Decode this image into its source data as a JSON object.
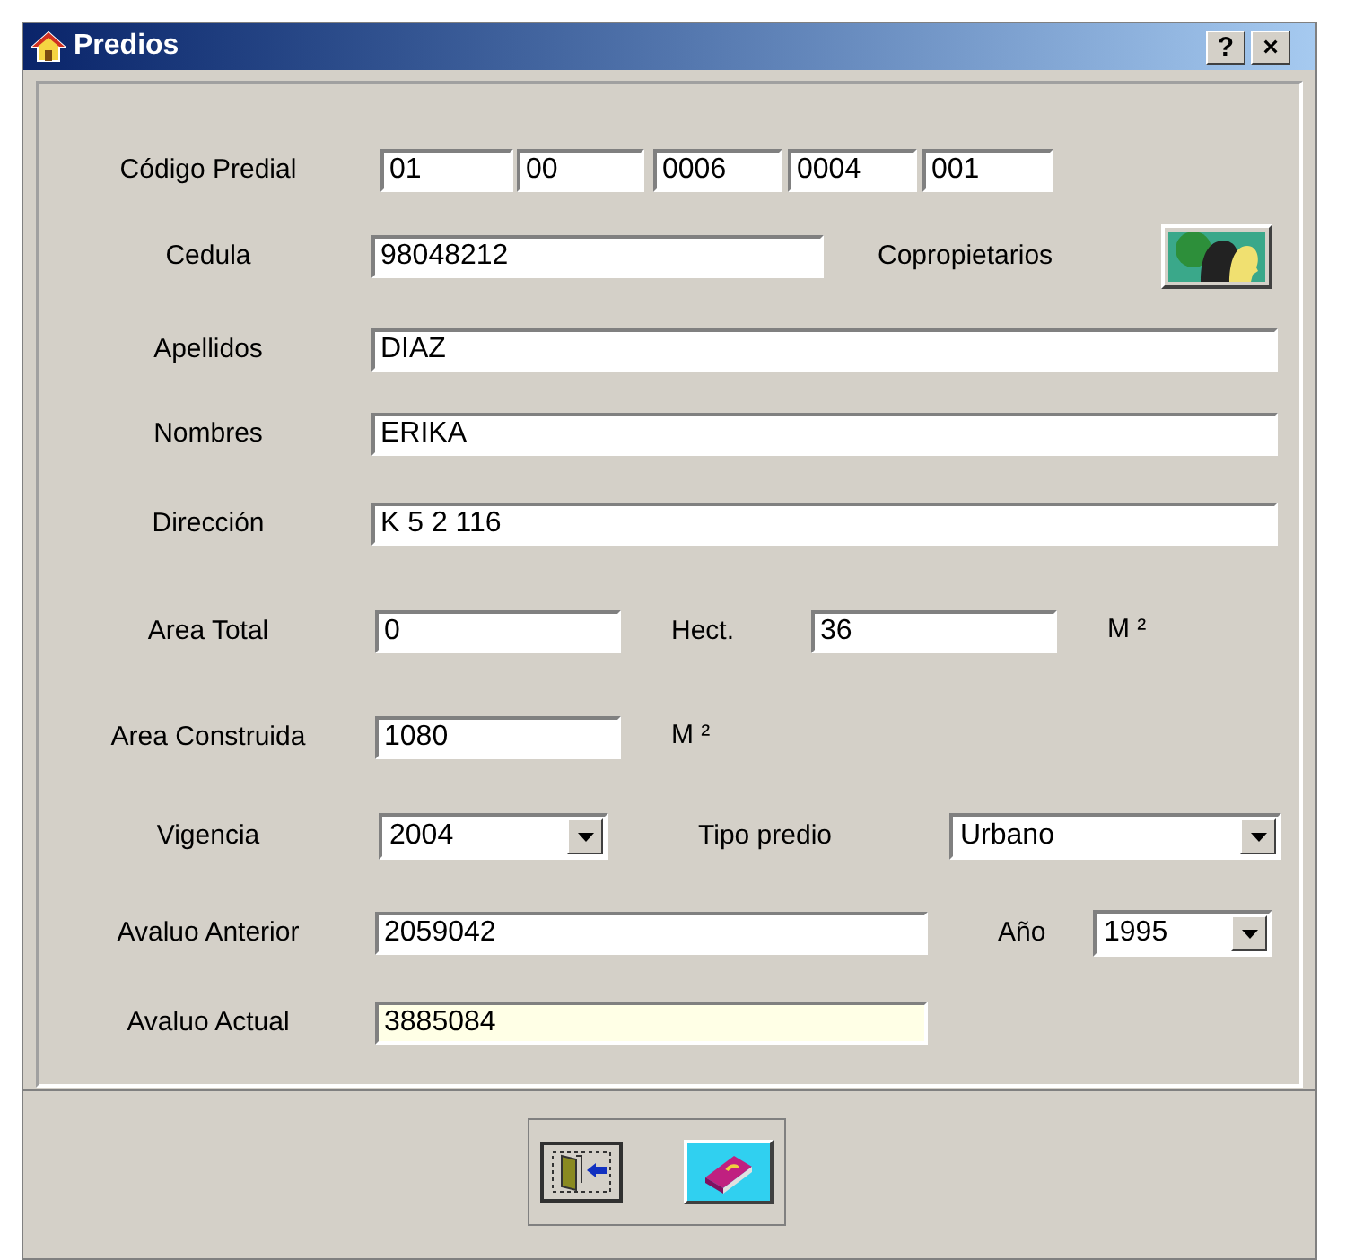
{
  "window": {
    "title": "Predios",
    "title_buttons": [
      "?",
      "×"
    ]
  },
  "rows": [
    {
      "label": "Código Predial",
      "controls": [
        {
          "kind": "field",
          "value": "01",
          "highlighted": false
        },
        {
          "kind": "field",
          "value": "00",
          "highlighted": false
        },
        {
          "kind": "field",
          "value": "0006",
          "highlighted": false
        },
        {
          "kind": "field",
          "value": "0004",
          "highlighted": false
        },
        {
          "kind": "field",
          "value": "001",
          "highlighted": false
        }
      ]
    },
    {
      "label": "Cedula",
      "controls": [
        {
          "kind": "field",
          "value": "98048212",
          "highlighted": false
        },
        {
          "kind": "text",
          "text": "Copropietarios"
        },
        {
          "kind": "people_button"
        }
      ]
    },
    {
      "label": "Apellidos",
      "controls": [
        {
          "kind": "field",
          "value": "DIAZ",
          "highlighted": false
        }
      ]
    },
    {
      "label": "Nombres",
      "controls": [
        {
          "kind": "field",
          "value": "ERIKA",
          "highlighted": false
        }
      ]
    },
    {
      "label": "Dirección",
      "controls": [
        {
          "kind": "field",
          "value": "K 5 2 116",
          "highlighted": false
        }
      ]
    },
    {
      "label": "Area Total",
      "controls": [
        {
          "kind": "field",
          "value": "0",
          "highlighted": false
        },
        {
          "kind": "text",
          "text": "Hect."
        },
        {
          "kind": "field",
          "value": "36",
          "highlighted": false
        },
        {
          "kind": "unit",
          "text": "M ²"
        }
      ]
    },
    {
      "label": "Area Construida",
      "controls": [
        {
          "kind": "field",
          "value": "1080",
          "highlighted": false
        },
        {
          "kind": "unit",
          "text": "M ²"
        }
      ]
    },
    {
      "label": "Vigencia",
      "controls": [
        {
          "kind": "combo",
          "value": "2004"
        },
        {
          "kind": "text",
          "text": "Tipo predio"
        },
        {
          "kind": "combo",
          "value": "Urbano"
        }
      ]
    },
    {
      "label": "Avaluo Anterior",
      "controls": [
        {
          "kind": "field",
          "value": "2059042",
          "highlighted": false
        },
        {
          "kind": "text",
          "text": "Año"
        },
        {
          "kind": "combo",
          "value": "1995"
        }
      ]
    },
    {
      "label": "Avaluo Actual",
      "controls": [
        {
          "kind": "field",
          "value": "3885084",
          "highlighted": true
        }
      ]
    }
  ],
  "footer_buttons": [
    {
      "kind": "exit"
    },
    {
      "kind": "help"
    }
  ]
}
